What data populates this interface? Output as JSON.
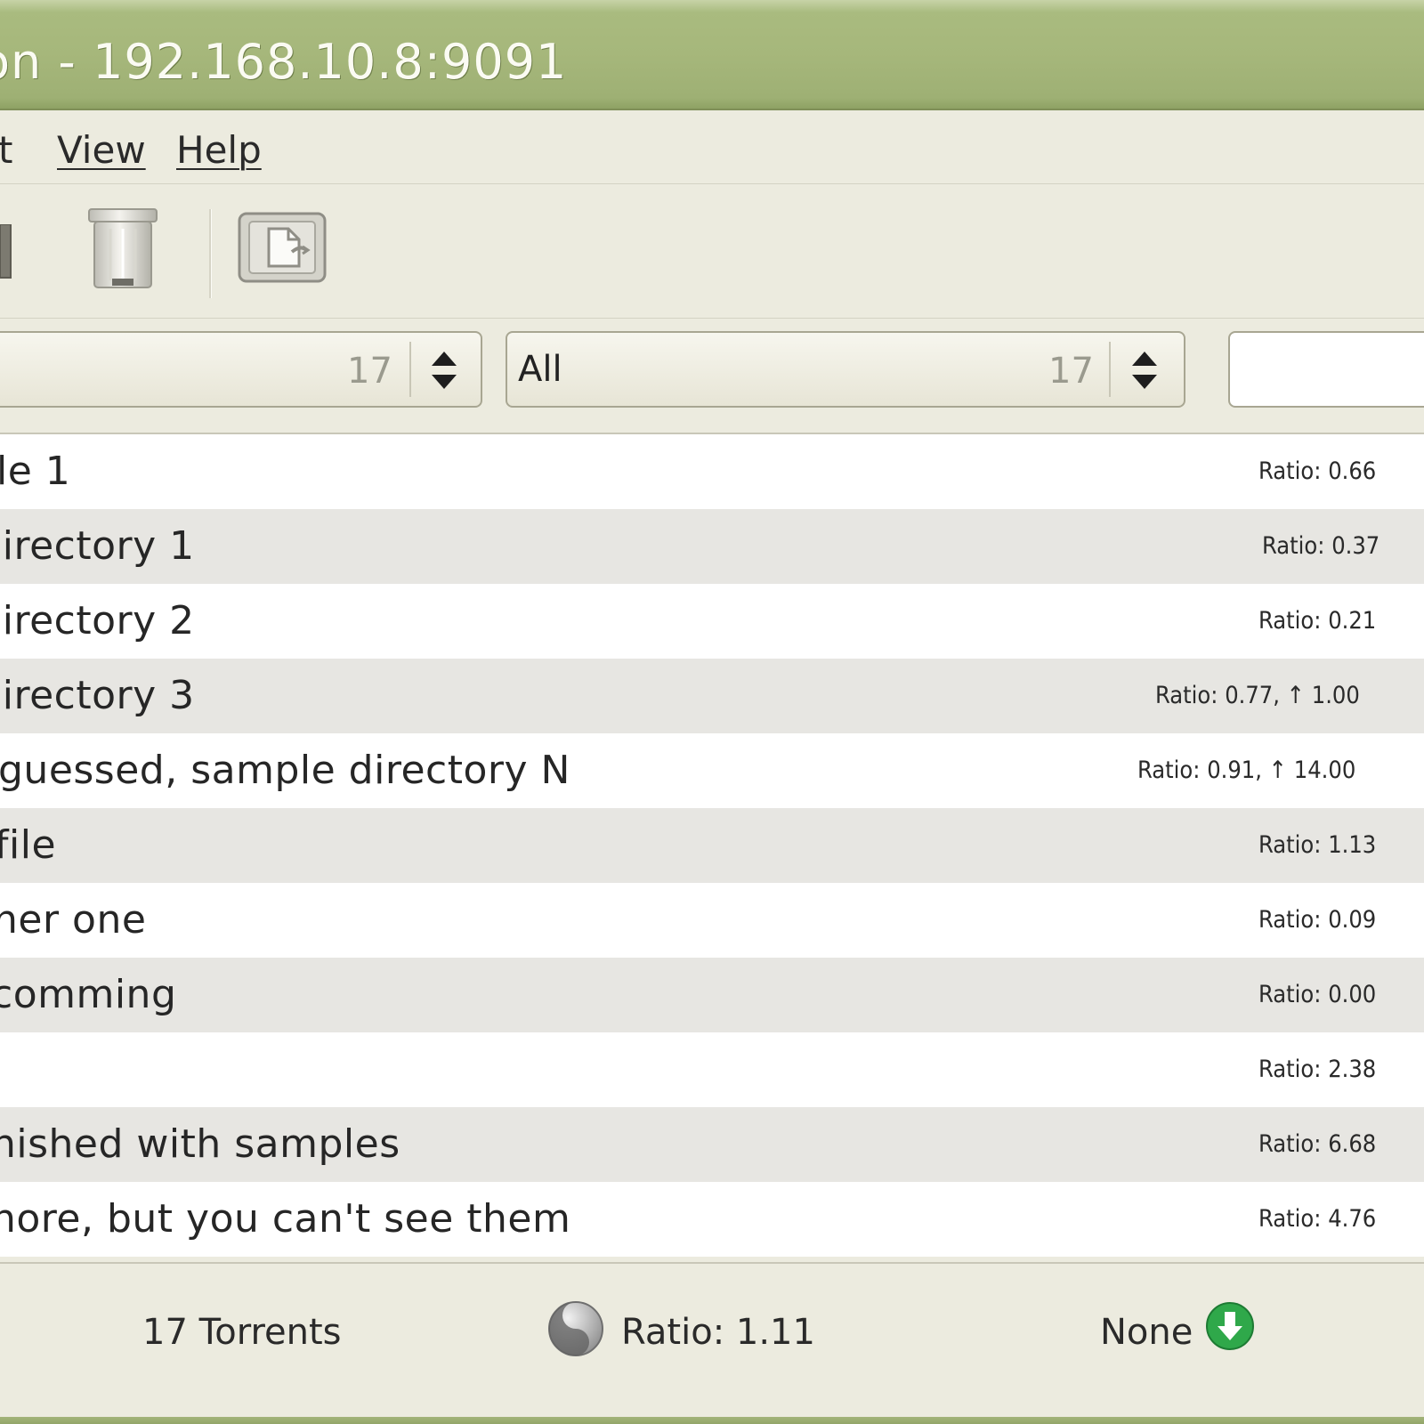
{
  "window": {
    "title": "on - 192.168.10.8:9091"
  },
  "menu": {
    "items": [
      {
        "label": "t"
      },
      {
        "label": "View"
      },
      {
        "label": "Help"
      }
    ]
  },
  "toolbar": {
    "icons": [
      "toolbar-partial-icon",
      "trash-icon",
      "properties-icon"
    ]
  },
  "filters": {
    "activity": {
      "label": "",
      "count": "17"
    },
    "tracker": {
      "label": "All",
      "count": "17"
    },
    "search": {
      "value": ""
    }
  },
  "torrents": [
    {
      "name": "le 1",
      "stats": "Ratio: 0.66"
    },
    {
      "name": "lirectory 1",
      "stats": "Ratio: 0.37"
    },
    {
      "name": "lirectory 2",
      "stats": "Ratio: 0.21"
    },
    {
      "name": "lirectory 3",
      "stats": "Ratio: 0.77, ↑ 1.00"
    },
    {
      "name": "guessed, sample directory N",
      "stats": "Ratio: 0.91, ↑ 14.00"
    },
    {
      "name": "file",
      "stats": "Ratio: 1.13"
    },
    {
      "name": "ner one",
      "stats": "Ratio: 0.09"
    },
    {
      "name": " comming",
      "stats": "Ratio: 0.00"
    },
    {
      "name": "",
      "stats": "Ratio: 2.38"
    },
    {
      "name": "nished with samples",
      "stats": "Ratio: 6.68"
    },
    {
      "name": "nore, but you can't see them",
      "stats": "Ratio: 4.76"
    }
  ],
  "status": {
    "torrent_count": "17 Torrents",
    "ratio": "Ratio: 1.11",
    "speed_limit": "None"
  },
  "colors": {
    "titlebar": "#a6b77b",
    "window_bg": "#ecebdf",
    "row_alt": "#e7e6e2",
    "download_green": "#2fa84a"
  }
}
